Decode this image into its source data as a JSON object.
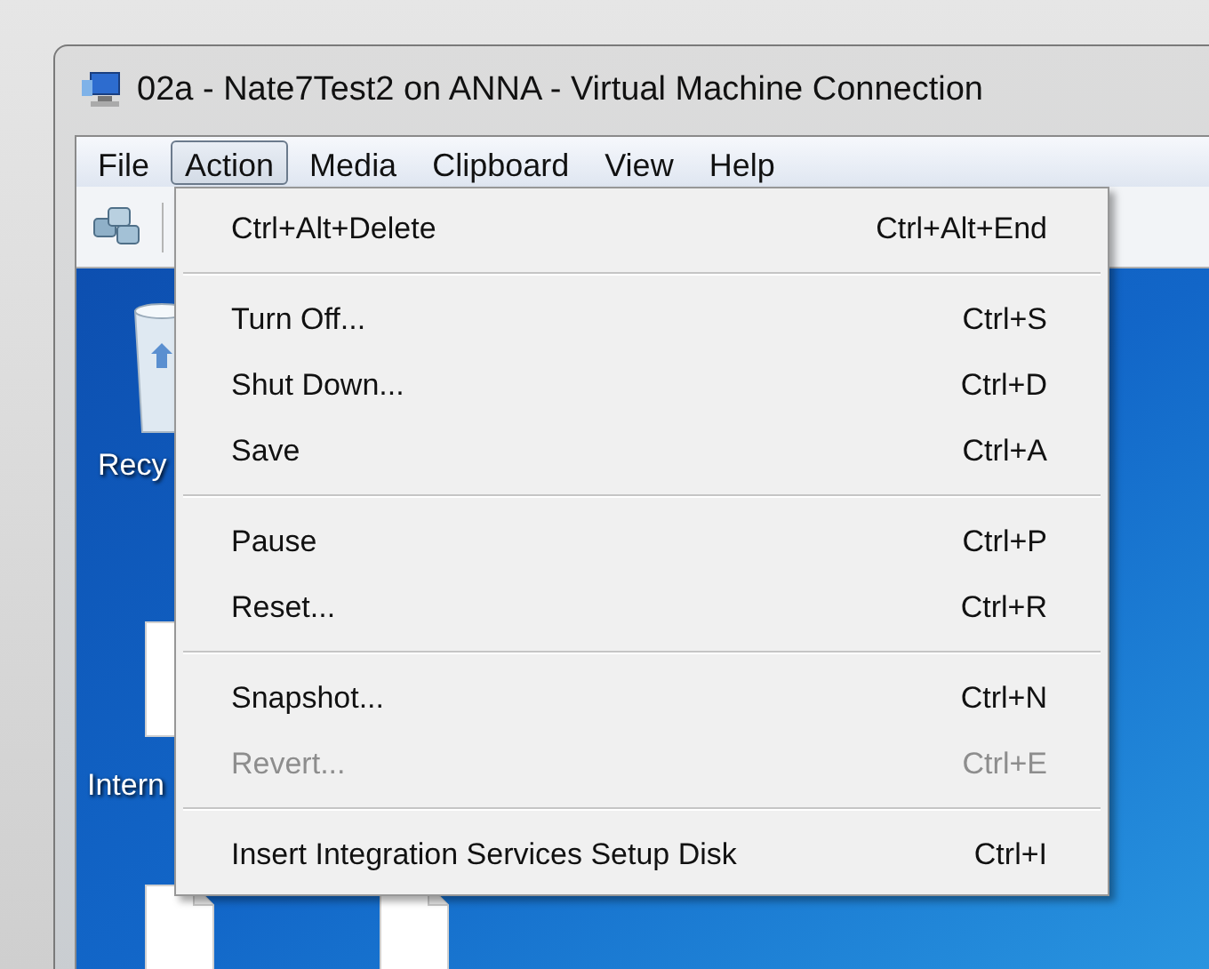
{
  "window": {
    "title": "02a - Nate7Test2 on ANNA - Virtual Machine Connection"
  },
  "menu_bar": [
    {
      "label": "File",
      "selected": false
    },
    {
      "label": "Action",
      "selected": true
    },
    {
      "label": "Media",
      "selected": false
    },
    {
      "label": "Clipboard",
      "selected": false
    },
    {
      "label": "View",
      "selected": false
    },
    {
      "label": "Help",
      "selected": false
    }
  ],
  "action_menu": {
    "items": [
      {
        "kind": "item",
        "label": "Ctrl+Alt+Delete",
        "shortcut": "Ctrl+Alt+End",
        "disabled": false
      },
      {
        "kind": "separator"
      },
      {
        "kind": "item",
        "label": "Turn Off...",
        "shortcut": "Ctrl+S",
        "disabled": false
      },
      {
        "kind": "item",
        "label": "Shut Down...",
        "shortcut": "Ctrl+D",
        "disabled": false
      },
      {
        "kind": "item",
        "label": "Save",
        "shortcut": "Ctrl+A",
        "disabled": false
      },
      {
        "kind": "separator"
      },
      {
        "kind": "item",
        "label": "Pause",
        "shortcut": "Ctrl+P",
        "disabled": false
      },
      {
        "kind": "item",
        "label": "Reset...",
        "shortcut": "Ctrl+R",
        "disabled": false
      },
      {
        "kind": "separator"
      },
      {
        "kind": "item",
        "label": "Snapshot...",
        "shortcut": "Ctrl+N",
        "disabled": false
      },
      {
        "kind": "item",
        "label": "Revert...",
        "shortcut": "Ctrl+E",
        "disabled": true
      },
      {
        "kind": "separator"
      },
      {
        "kind": "item",
        "label": "Insert Integration Services Setup Disk",
        "shortcut": "Ctrl+I",
        "disabled": false
      }
    ]
  },
  "desktop": {
    "icons": [
      {
        "kind": "recycle",
        "label": "Recy"
      },
      {
        "kind": "page",
        "label": "Intern"
      },
      {
        "kind": "page"
      },
      {
        "kind": "page"
      }
    ]
  }
}
